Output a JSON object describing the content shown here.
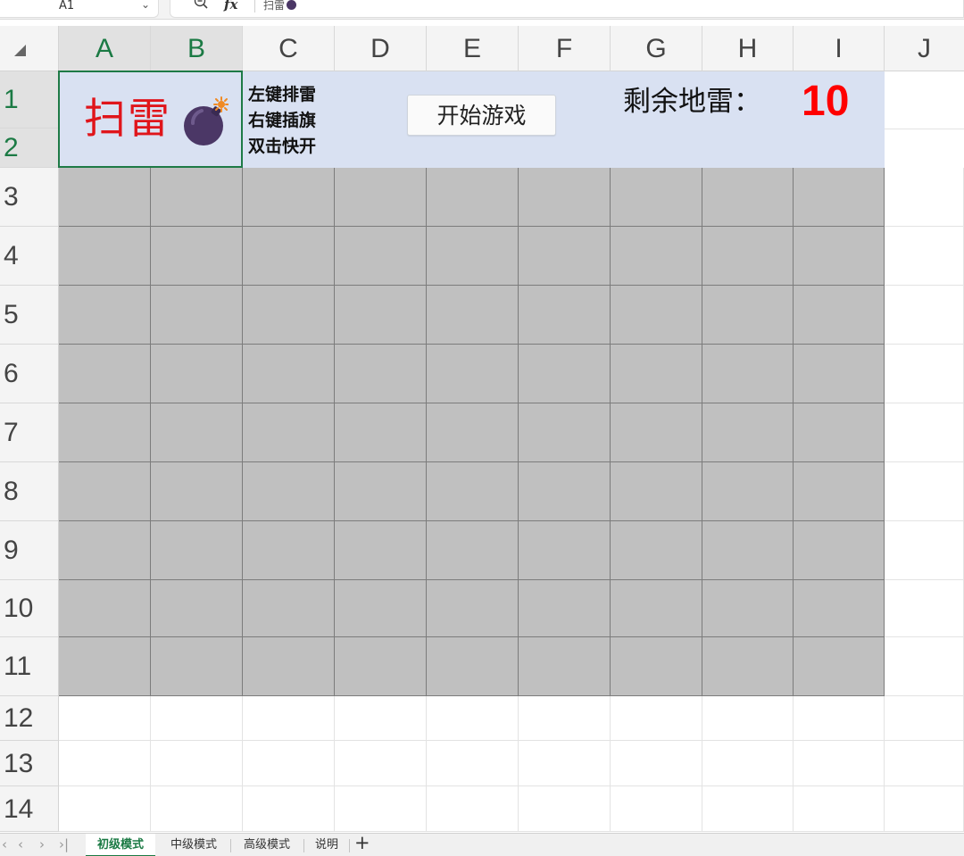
{
  "formula_bar": {
    "name_box": "A1",
    "chevron_icon": "chevron-down-icon",
    "zoom_icon": "zoom-out-icon",
    "fx_label": "fx",
    "content": "扫雷"
  },
  "columns": [
    "A",
    "B",
    "C",
    "D",
    "E",
    "F",
    "G",
    "H",
    "I",
    "J"
  ],
  "rows": [
    "1",
    "2",
    "3",
    "4",
    "5",
    "6",
    "7",
    "8",
    "9",
    "10",
    "11",
    "12",
    "13",
    "14"
  ],
  "selection": {
    "cell": "A1",
    "merged_range": "A1:B2"
  },
  "game": {
    "title": "扫雷",
    "bomb_icon": "bomb-icon",
    "instructions": [
      "左键排雷",
      "右键插旗",
      "双击快开"
    ],
    "start_button": "开始游戏",
    "remaining_label": "剩余地雷：",
    "remaining_count": "10",
    "board": {
      "rows": 9,
      "cols": 9,
      "state": "unrevealed"
    }
  },
  "colors": {
    "header_panel": "#d9e1f2",
    "unrevealed_cell": "#c0c0c0",
    "title_red": "#e0151b",
    "counter_red": "#ff0000",
    "selection_green": "#1e7a46",
    "bomb_purple": "#4b3766",
    "fuse_orange": "#f08a24"
  },
  "sheet_tabs": {
    "tabs": [
      "初级模式",
      "中级模式",
      "高级模式",
      "说明"
    ],
    "active": "初级模式",
    "add_label": "+"
  }
}
